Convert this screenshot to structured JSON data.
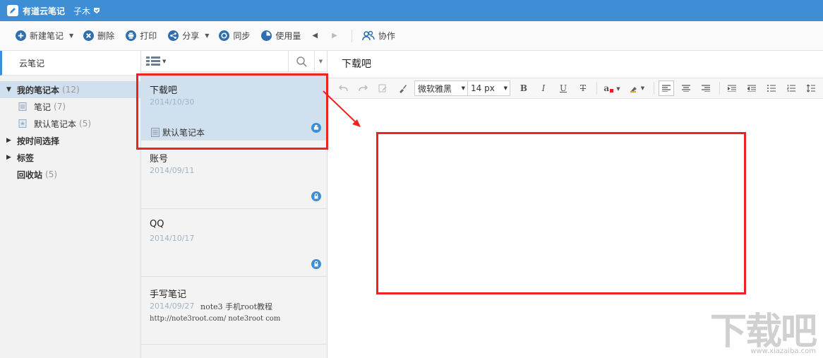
{
  "app": {
    "title": "有道云笔记",
    "user": "子木"
  },
  "toolbar": {
    "new_note": "新建笔记",
    "delete": "删除",
    "print": "打印",
    "share": "分享",
    "sync": "同步",
    "usage": "使用量",
    "collab": "协作"
  },
  "sidebar": {
    "header": "云笔记",
    "my_notebooks": {
      "label": "我的笔记本",
      "count": "(12)"
    },
    "notebooks": [
      {
        "label": "笔记",
        "count": "(7)"
      },
      {
        "label": "默认笔记本",
        "count": "(5)"
      }
    ],
    "by_time": "按时间选择",
    "tags": "标签",
    "trash": {
      "label": "回收站",
      "count": "(5)"
    }
  },
  "notes": [
    {
      "title": "下载吧",
      "date": "2014/10/30",
      "notebook": "默认笔记本",
      "selected": true
    },
    {
      "title": "账号",
      "date": "2014/09/11"
    },
    {
      "title": "QQ",
      "date": "2014/10/17"
    },
    {
      "title": "手写笔记",
      "date": "2014/09/27",
      "snippet": "note3 手机root教程",
      "snippet2": "http://note3root.com/ note3root com"
    }
  ],
  "editor": {
    "title": "下载吧",
    "font_family": "微软雅黑",
    "font_size": "14 px",
    "bold": "B",
    "italic": "I",
    "underline": "U",
    "strike": "T",
    "text_color": "a"
  },
  "watermark": {
    "text": "下载吧",
    "url": "www.xiazaiba.com"
  },
  "colors": {
    "accent": "#3d8ed5",
    "highlight": "#e22222",
    "selected": "#d0e0ee"
  }
}
